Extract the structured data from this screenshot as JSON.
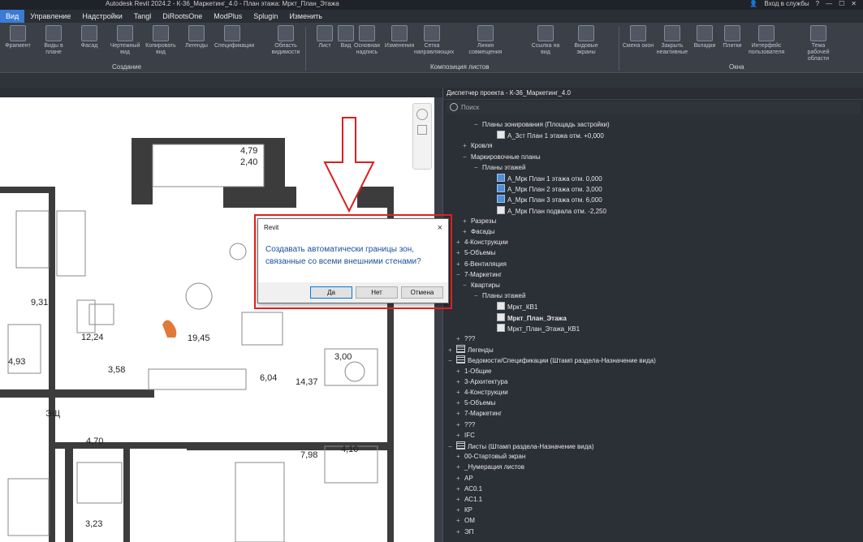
{
  "window": {
    "title": "Autodesk Revit 2024.2 - К-36_Маркетинг_4.0 - План этажа: Мркт_План_Этажа",
    "signin": "Вход в службы"
  },
  "menu": [
    "Вид",
    "Управление",
    "Надстройки",
    "Tangl",
    "DiRootsOne",
    "ModPlus",
    "Splugin",
    "Изменить"
  ],
  "ribbon": {
    "tools": [
      {
        "label": "Фрагмент"
      },
      {
        "label": "Виды в плане"
      },
      {
        "label": "Фасад"
      },
      {
        "label": "Чертежный вид"
      },
      {
        "label": "Копировать вид"
      },
      {
        "label": "Легенды"
      },
      {
        "label": "Спецификации"
      },
      {
        "label": "Область видимости"
      },
      {
        "label": "Лист"
      },
      {
        "label": "Вид"
      },
      {
        "label": "Основная надпись"
      },
      {
        "label": "Изменения"
      },
      {
        "label": "Сетка направляющих"
      },
      {
        "label": "Линия совмещения"
      },
      {
        "label": "Ссылка на вид"
      },
      {
        "label": "Видовые экраны"
      },
      {
        "label": "Смена окон"
      },
      {
        "label": "Закрыть неактивные"
      },
      {
        "label": "Вкладки"
      },
      {
        "label": "Плитки"
      },
      {
        "label": "Интерфейс пользователя"
      },
      {
        "label": "Тема рабочей области"
      }
    ],
    "panels": [
      "Создание",
      "Композиция листов",
      "Окна"
    ]
  },
  "drawing": {
    "room_labels": [
      "4,79",
      "2,40",
      "9,31",
      "12,24",
      "19,45",
      "4,93",
      "3,58",
      "6,04",
      "14,37",
      "3,00",
      "ЭЩ",
      "4,70",
      "7,98",
      "4,10",
      "3,23"
    ]
  },
  "dialog": {
    "title": "Revit",
    "close": "×",
    "message": "Создавать автоматически границы зон, связанные со всеми внешними стенами?",
    "buttons": {
      "yes": "Да",
      "no": "Нет",
      "cancel": "Отмена"
    }
  },
  "browser": {
    "title": "Диспетчер проекта - К-36_Маркетинг_4.0",
    "search_placeholder": "Поиск",
    "rows": [
      {
        "text": "Планы зонирования (Площадь застройки)",
        "toggle": "−",
        "icon": "none"
      },
      {
        "text": "А_3ст План 1 этажа отм. +0,000",
        "toggle": "",
        "icon": "view"
      },
      {
        "text": "Кровля",
        "toggle": "+",
        "icon": "none"
      },
      {
        "text": "Маркировочные планы",
        "toggle": "−",
        "icon": "none"
      },
      {
        "text": "Планы этажей",
        "toggle": "−",
        "icon": "none"
      },
      {
        "text": "А_Мрк План 1 этажа отм. 0,000",
        "toggle": "",
        "icon": "blue"
      },
      {
        "text": "А_Мрк План 2 этажа отм. 3,000",
        "toggle": "",
        "icon": "blue"
      },
      {
        "text": "А_Мрк План 3 этажа отм. 6,000",
        "toggle": "",
        "icon": "blue"
      },
      {
        "text": "А_Мрк План подвала отм. -2,250",
        "toggle": "",
        "icon": "view"
      },
      {
        "text": "Разрезы",
        "toggle": "+",
        "icon": "none"
      },
      {
        "text": "Фасады",
        "toggle": "+",
        "icon": "none"
      },
      {
        "text": "4-Конструкции",
        "toggle": "+",
        "icon": "none"
      },
      {
        "text": "5-Объемы",
        "toggle": "+",
        "icon": "none"
      },
      {
        "text": "6-Вентиляция",
        "toggle": "+",
        "icon": "none"
      },
      {
        "text": "7-Маркетинг",
        "toggle": "−",
        "icon": "none"
      },
      {
        "text": "Квартиры",
        "toggle": "−",
        "icon": "none"
      },
      {
        "text": "Планы этажей",
        "toggle": "−",
        "icon": "none"
      },
      {
        "text": "Мркт_КВ1",
        "toggle": "",
        "icon": "view"
      },
      {
        "text": "Мркт_План_Этажа",
        "toggle": "",
        "icon": "view",
        "bold": true
      },
      {
        "text": "Мркт_План_Этажа_КВ1",
        "toggle": "",
        "icon": "view"
      },
      {
        "text": "???",
        "toggle": "+",
        "icon": "none"
      },
      {
        "text": "Легенды",
        "toggle": "+",
        "icon": "legend"
      },
      {
        "text": "Ведомости/Спецификации (Штамп раздела-Назначение вида)",
        "toggle": "−",
        "icon": "legend"
      },
      {
        "text": "1-Общие",
        "toggle": "+",
        "icon": "none"
      },
      {
        "text": "3-Архитектура",
        "toggle": "+",
        "icon": "none"
      },
      {
        "text": "4-Конструкции",
        "toggle": "+",
        "icon": "none"
      },
      {
        "text": "5-Объемы",
        "toggle": "+",
        "icon": "none"
      },
      {
        "text": "7-Маркетинг",
        "toggle": "+",
        "icon": "none"
      },
      {
        "text": "???",
        "toggle": "+",
        "icon": "none"
      },
      {
        "text": "IFC",
        "toggle": "+",
        "icon": "none"
      },
      {
        "text": "Листы (Штамп раздела-Назначение вида)",
        "toggle": "−",
        "icon": "sheet"
      },
      {
        "text": "00-Стартовый экран",
        "toggle": "+",
        "icon": "none"
      },
      {
        "text": "_Нумерация листов",
        "toggle": "+",
        "icon": "none"
      },
      {
        "text": "АР",
        "toggle": "+",
        "icon": "none"
      },
      {
        "text": "АС0.1",
        "toggle": "+",
        "icon": "none"
      },
      {
        "text": "АС1.1",
        "toggle": "+",
        "icon": "none"
      },
      {
        "text": "КР",
        "toggle": "+",
        "icon": "none"
      },
      {
        "text": "ОМ",
        "toggle": "+",
        "icon": "none"
      },
      {
        "text": "ЭП",
        "toggle": "+",
        "icon": "none"
      }
    ]
  },
  "colors": {
    "accent": "#3a7bd5",
    "highlight": "#e0201f",
    "dialog_text": "#1c4fa1"
  }
}
